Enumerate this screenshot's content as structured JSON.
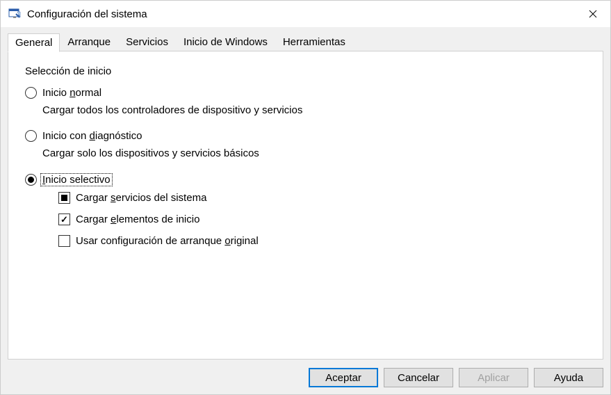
{
  "window": {
    "title": "Configuración del sistema"
  },
  "tabs": [
    {
      "label": "General"
    },
    {
      "label": "Arranque"
    },
    {
      "label": "Servicios"
    },
    {
      "label": "Inicio de Windows"
    },
    {
      "label": "Herramientas"
    }
  ],
  "group": {
    "legend": "Selección de inicio"
  },
  "radios": {
    "normal": {
      "pre": "Inicio ",
      "u": "n",
      "post": "ormal",
      "desc": "Cargar todos los controladores de dispositivo y servicios"
    },
    "diag": {
      "pre": "Inicio con ",
      "u": "d",
      "post": "iagnóstico",
      "desc": "Cargar solo los dispositivos y servicios básicos"
    },
    "selective": {
      "pre": "",
      "u": "I",
      "post": "nicio selectivo"
    }
  },
  "checks": {
    "services": {
      "pre": "Cargar ",
      "u": "s",
      "post": "ervicios del sistema"
    },
    "startup": {
      "pre": "Cargar ",
      "u": "e",
      "post": "lementos de inicio"
    },
    "bootcfg": {
      "pre": "Usar configuración de arranque ",
      "u": "o",
      "post": "riginal"
    }
  },
  "buttons": {
    "ok": "Aceptar",
    "cancel": "Cancelar",
    "apply": "Aplicar",
    "help": "Ayuda"
  }
}
